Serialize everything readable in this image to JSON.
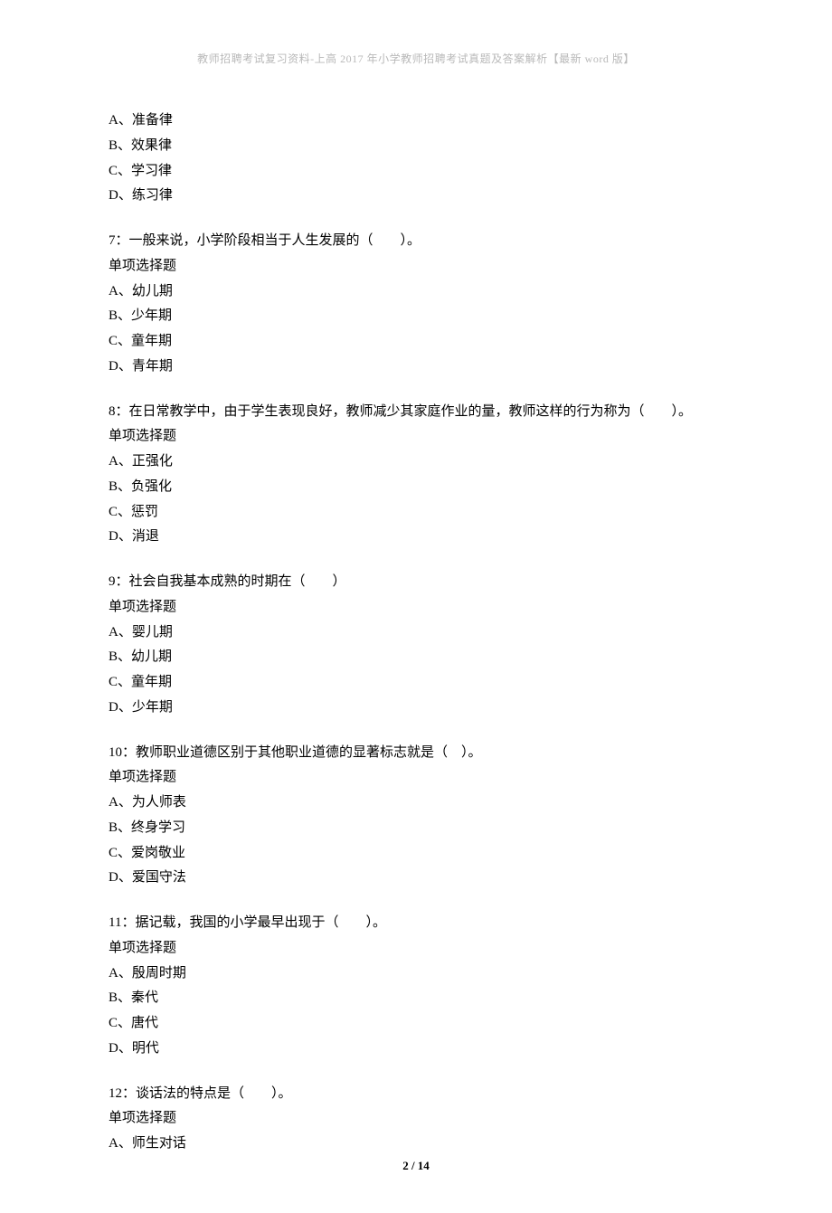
{
  "header": "教师招聘考试复习资料-上高 2017 年小学教师招聘考试真题及答案解析【最新 word 版】",
  "q6": {
    "options": [
      "A、准备律",
      "B、效果律",
      "C、学习律",
      "D、练习律"
    ]
  },
  "q7": {
    "stem": "7：一般来说，小学阶段相当于人生发展的（　　）。",
    "type": "单项选择题",
    "options": [
      "A、幼儿期",
      "B、少年期",
      "C、童年期",
      "D、青年期"
    ]
  },
  "q8": {
    "stem": "8：在日常教学中，由于学生表现良好，教师减少其家庭作业的量，教师这样的行为称为（　　）。",
    "type": "单项选择题",
    "options": [
      "A、正强化",
      "B、负强化",
      "C、惩罚",
      "D、消退"
    ]
  },
  "q9": {
    "stem": "9：社会自我基本成熟的时期在（　　）",
    "type": "单项选择题",
    "options": [
      "A、婴儿期",
      "B、幼儿期",
      "C、童年期",
      "D、少年期"
    ]
  },
  "q10": {
    "stem": "10：教师职业道德区别于其他职业道德的显著标志就是（　）。",
    "type": "单项选择题",
    "options": [
      "A、为人师表",
      "B、终身学习",
      "C、爱岗敬业",
      "D、爱国守法"
    ]
  },
  "q11": {
    "stem": "11：据记载，我国的小学最早出现于（　　）。",
    "type": "单项选择题",
    "options": [
      "A、殷周时期",
      "B、秦代",
      "C、唐代",
      "D、明代"
    ]
  },
  "q12": {
    "stem": "12：谈话法的特点是（　　）。",
    "type": "单项选择题",
    "options": [
      "A、师生对话"
    ]
  },
  "footer": "2 / 14"
}
